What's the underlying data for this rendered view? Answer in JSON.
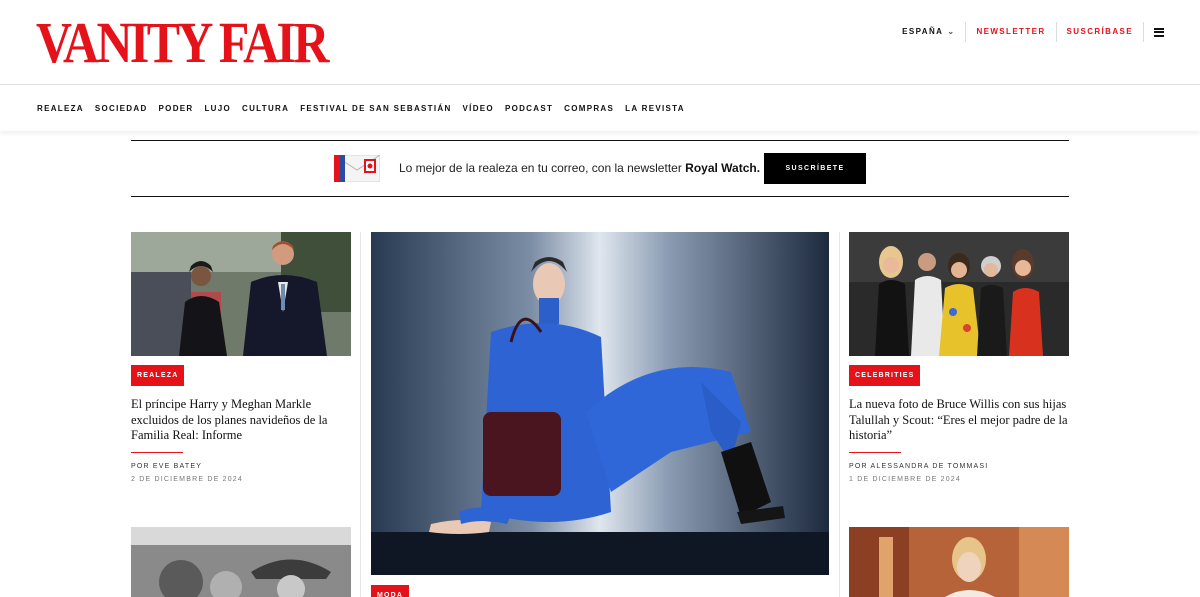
{
  "header": {
    "logo": "VANITY FAIR",
    "edition": "ESPAÑA",
    "newsletter": "NEWSLETTER",
    "subscribe": "SUSCRÍBASE"
  },
  "nav": {
    "items": [
      "REALEZA",
      "SOCIEDAD",
      "PODER",
      "LUJO",
      "CULTURA",
      "FESTIVAL DE SAN SEBASTIÁN",
      "VÍDEO",
      "PODCAST",
      "COMPRAS",
      "LA REVISTA"
    ]
  },
  "banner": {
    "text_prefix": "Lo mejor de la realeza en tu correo, con la newsletter ",
    "text_bold": "Royal Watch.",
    "button": "SUSCRÍBETE"
  },
  "articles": [
    {
      "tag": "REALEZA",
      "headline": "El príncipe Harry y Meghan Markle excluidos de los planes navideños de la Familia Real: Informe",
      "byline": "POR EVE BATEY",
      "date": "2 DE DICIEMBRE DE 2024"
    },
    {
      "tag": "CELEBRITIES",
      "headline": "La nueva foto de Bruce Willis con sus hijas Talullah y Scout: “Eres el mejor padre de la historia”",
      "byline": "POR ALESSANDRA DE TOMMASI",
      "date": "1 DE DICIEMBRE DE 2024"
    },
    {
      "tag": "MODA"
    }
  ],
  "colors": {
    "brand_red": "#e5121a",
    "black": "#000000"
  }
}
